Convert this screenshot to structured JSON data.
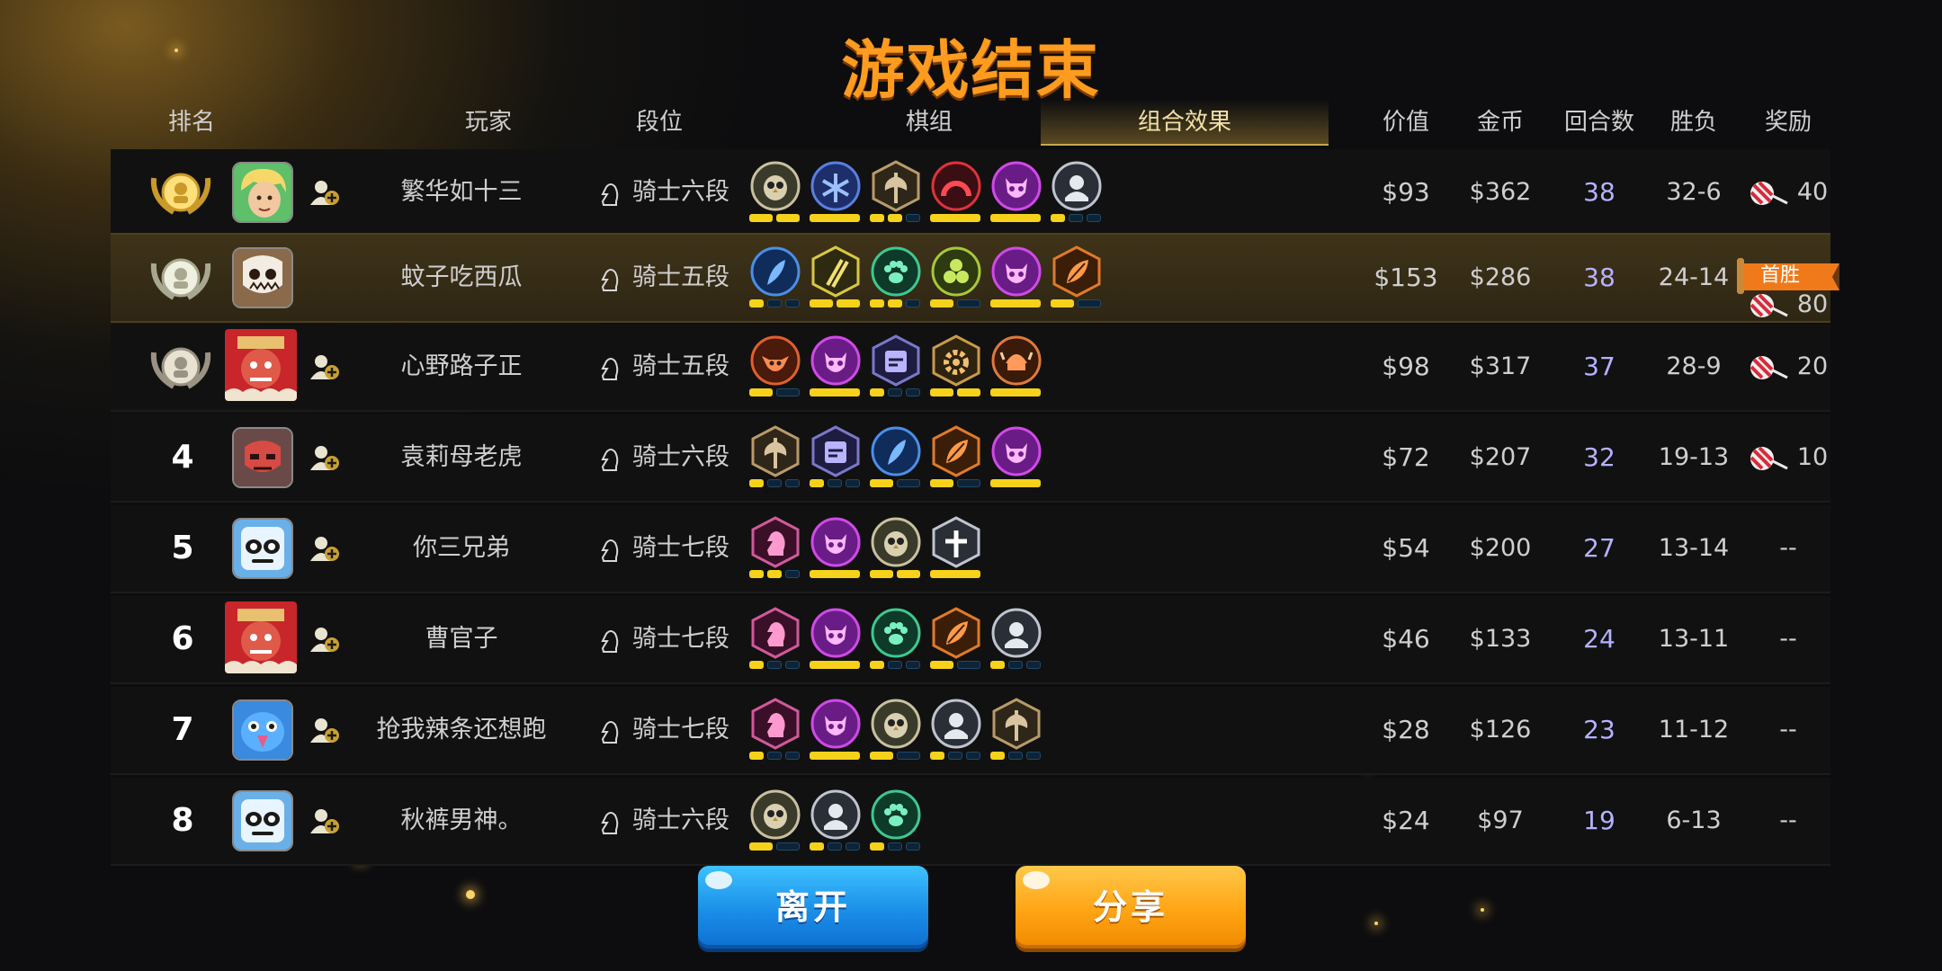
{
  "title": "游戏结束",
  "header": {
    "rank": "排名",
    "player": "玩家",
    "tier": "段位",
    "pieces_tab": "棋组",
    "synergy_tab": "组合效果",
    "value": "价值",
    "gold": "金币",
    "rounds": "回合数",
    "win_loss": "胜负",
    "reward": "奖励"
  },
  "rows": [
    {
      "rank": "1",
      "medal": "gold",
      "name": "繁华如十三",
      "tier": "骑士六段",
      "value": "$93",
      "gold": "$362",
      "rounds": "38",
      "wl": "32-6",
      "reward": "40",
      "avatar": "blonde-hero",
      "icons": [
        {
          "kind": "owl-icon",
          "ring": "#c8c0a0",
          "fill": "#3a3a2a"
        },
        {
          "kind": "snowflake-icon",
          "ring": "#5a7fe0",
          "fill": "#1e2e6a"
        },
        {
          "kind": "axe-icon",
          "ring": "#b99a6a",
          "fill": "#2e2618"
        },
        {
          "kind": "arch-icon",
          "ring": "#e0323c",
          "fill": "#3a0e12"
        },
        {
          "kind": "demon-icon",
          "ring": "#d04ae8",
          "fill": "#6a1c86"
        },
        {
          "kind": "helmet-icon",
          "ring": "#bfc4cf",
          "fill": "#2a2e36"
        }
      ],
      "bars": [
        [
          1,
          1
        ],
        [
          1
        ],
        [
          1,
          1,
          0
        ],
        [
          1
        ],
        [
          1
        ],
        [
          1,
          0,
          0
        ]
      ]
    },
    {
      "rank": "2",
      "medal": "silver",
      "name": "蚊子吃西瓜",
      "tier": "骑士五段",
      "value": "$153",
      "gold": "$286",
      "rounds": "38",
      "wl": "24-14",
      "reward": "80",
      "banner": "首胜",
      "avatar": "skull-mask",
      "icons": [
        {
          "kind": "feather-icon",
          "ring": "#4a8fe8",
          "fill": "#102c5a"
        },
        {
          "kind": "daggers-icon",
          "ring": "#d8c840",
          "fill": "#2e2a10"
        },
        {
          "kind": "paw-icon",
          "ring": "#3ec890",
          "fill": "#0e3a2a"
        },
        {
          "kind": "orbs-icon",
          "ring": "#a8c838",
          "fill": "#2e3a10"
        },
        {
          "kind": "demon-icon",
          "ring": "#d04ae8",
          "fill": "#6a1c86"
        },
        {
          "kind": "leaf-icon",
          "ring": "#e07a28",
          "fill": "#3a1e08"
        }
      ],
      "bars": [
        [
          1,
          0,
          0
        ],
        [
          1,
          1
        ],
        [
          1,
          1,
          0
        ],
        [
          1,
          0
        ],
        [
          1
        ],
        [
          1,
          0
        ]
      ]
    },
    {
      "rank": "3",
      "medal": "bronze",
      "name": "心野路子正",
      "tier": "骑士五段",
      "value": "$98",
      "gold": "$317",
      "rounds": "37",
      "wl": "28-9",
      "reward": "20",
      "avatar": "red-warrior",
      "icons": [
        {
          "kind": "goblin-icon",
          "ring": "#e0602c",
          "fill": "#4a1a0a"
        },
        {
          "kind": "demon-icon",
          "ring": "#d04ae8",
          "fill": "#6a1c86"
        },
        {
          "kind": "tablet-icon",
          "ring": "#7a78c8",
          "fill": "#1e1c40"
        },
        {
          "kind": "gear-icon",
          "ring": "#c89a4a",
          "fill": "#2e2210"
        },
        {
          "kind": "viking-icon",
          "ring": "#e07a3a",
          "fill": "#3a1a08"
        }
      ],
      "bars": [
        [
          1,
          0
        ],
        [
          1
        ],
        [
          1,
          0,
          0
        ],
        [
          1,
          1
        ],
        [
          1
        ]
      ]
    },
    {
      "rank": "4",
      "name": "袁莉母老虎",
      "tier": "骑士六段",
      "value": "$72",
      "gold": "$207",
      "rounds": "32",
      "wl": "19-13",
      "reward": "10",
      "avatar": "red-skull",
      "icons": [
        {
          "kind": "axe-icon",
          "ring": "#b99a6a",
          "fill": "#2e2618"
        },
        {
          "kind": "tablet-icon",
          "ring": "#7a78c8",
          "fill": "#1e1c40"
        },
        {
          "kind": "feather-icon",
          "ring": "#4a8fe8",
          "fill": "#102c5a"
        },
        {
          "kind": "leaf-icon",
          "ring": "#e07a28",
          "fill": "#3a1e08"
        },
        {
          "kind": "demon-icon",
          "ring": "#d04ae8",
          "fill": "#6a1c86"
        }
      ],
      "bars": [
        [
          1,
          0,
          0
        ],
        [
          1,
          0,
          0
        ],
        [
          1,
          0
        ],
        [
          1,
          0
        ],
        [
          1
        ]
      ]
    },
    {
      "rank": "5",
      "name": "你三兄弟",
      "tier": "骑士七段",
      "value": "$54",
      "gold": "$200",
      "rounds": "27",
      "wl": "13-14",
      "reward": "--",
      "avatar": "panda-cube",
      "icons": [
        {
          "kind": "knight-icon",
          "ring": "#d05a9a",
          "fill": "#3a1028"
        },
        {
          "kind": "demon-icon",
          "ring": "#d04ae8",
          "fill": "#6a1c86"
        },
        {
          "kind": "owl-icon",
          "ring": "#c8c0a0",
          "fill": "#3a3a2a"
        },
        {
          "kind": "cross-icon",
          "ring": "#bfc4cf",
          "fill": "#2a2e36"
        }
      ],
      "bars": [
        [
          1,
          1,
          0
        ],
        [
          1
        ],
        [
          1,
          1
        ],
        [
          1
        ]
      ]
    },
    {
      "rank": "6",
      "name": "曹官子",
      "tier": "骑士七段",
      "value": "$46",
      "gold": "$133",
      "rounds": "24",
      "wl": "13-11",
      "reward": "--",
      "avatar": "red-warrior",
      "icons": [
        {
          "kind": "knight-icon",
          "ring": "#d05a9a",
          "fill": "#3a1028"
        },
        {
          "kind": "demon-icon",
          "ring": "#d04ae8",
          "fill": "#6a1c86"
        },
        {
          "kind": "paw-icon",
          "ring": "#3ec890",
          "fill": "#0e3a2a"
        },
        {
          "kind": "leaf-icon",
          "ring": "#e07a28",
          "fill": "#3a1e08"
        },
        {
          "kind": "helmet-icon",
          "ring": "#bfc4cf",
          "fill": "#2a2e36"
        }
      ],
      "bars": [
        [
          1,
          0,
          0
        ],
        [
          1
        ],
        [
          1,
          0,
          0
        ],
        [
          1,
          0
        ],
        [
          1,
          0,
          0
        ]
      ]
    },
    {
      "rank": "7",
      "name": "抢我辣条还想跑",
      "tier": "骑士七段",
      "value": "$28",
      "gold": "$126",
      "rounds": "23",
      "wl": "11-12",
      "reward": "--",
      "avatar": "blue-bird",
      "icons": [
        {
          "kind": "knight-icon",
          "ring": "#d05a9a",
          "fill": "#3a1028"
        },
        {
          "kind": "demon-icon",
          "ring": "#d04ae8",
          "fill": "#6a1c86"
        },
        {
          "kind": "owl-icon",
          "ring": "#c8c0a0",
          "fill": "#3a3a2a"
        },
        {
          "kind": "helmet-icon",
          "ring": "#bfc4cf",
          "fill": "#2a2e36"
        },
        {
          "kind": "axe-icon",
          "ring": "#b99a6a",
          "fill": "#2e2618"
        }
      ],
      "bars": [
        [
          1,
          0,
          0
        ],
        [
          1
        ],
        [
          1,
          0
        ],
        [
          1,
          0,
          0
        ],
        [
          1,
          0,
          0
        ]
      ]
    },
    {
      "rank": "8",
      "name": "秋裤男神。",
      "tier": "骑士六段",
      "value": "$24",
      "gold": "$97",
      "rounds": "19",
      "wl": "6-13",
      "reward": "--",
      "avatar": "panda-cube",
      "icons": [
        {
          "kind": "owl-icon",
          "ring": "#c8c0a0",
          "fill": "#3a3a2a"
        },
        {
          "kind": "helmet-icon",
          "ring": "#bfc4cf",
          "fill": "#2a2e36"
        },
        {
          "kind": "paw-icon",
          "ring": "#3ec890",
          "fill": "#0e3a2a"
        }
      ],
      "bars": [
        [
          1,
          0
        ],
        [
          1,
          0,
          0
        ],
        [
          1,
          0,
          0
        ]
      ]
    }
  ],
  "buttons": {
    "leave": "离开",
    "share": "分享"
  }
}
